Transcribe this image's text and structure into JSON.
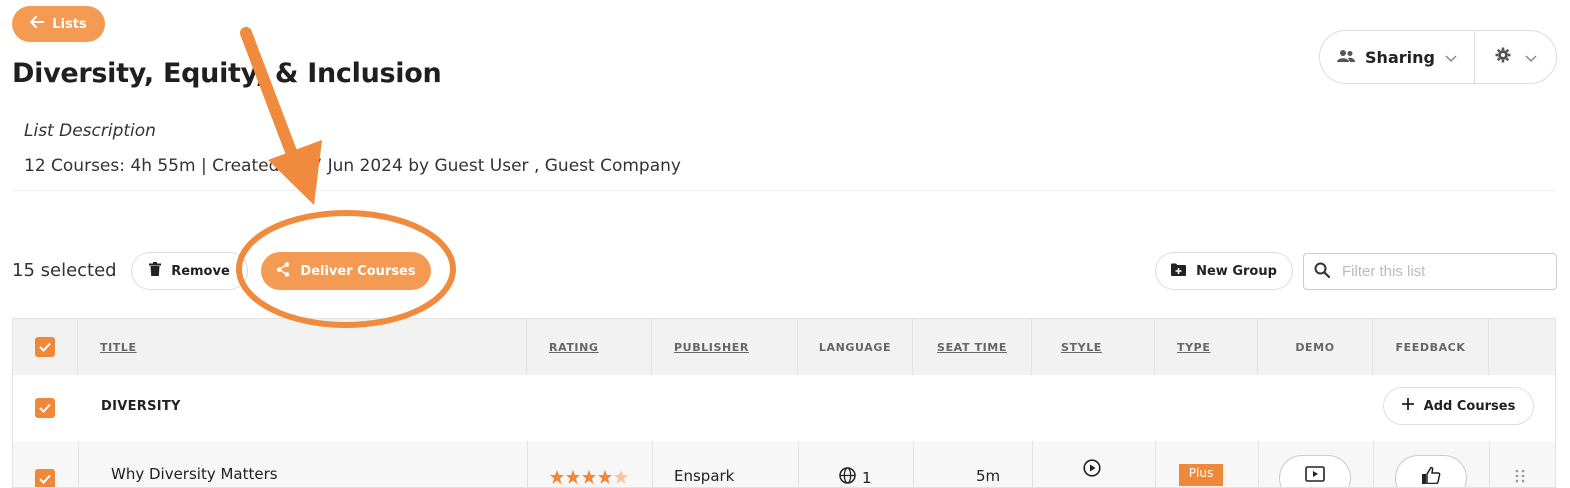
{
  "header": {
    "back_label": "Lists",
    "title": "Diversity, Equity, & Inclusion",
    "description_label": "List Description",
    "meta": "12 Courses: 4h 55m | Created on 7 Jun 2024 by Guest User , Guest Company"
  },
  "sharing": {
    "label": "Sharing"
  },
  "toolbar": {
    "selected": "15 selected",
    "remove_label": "Remove",
    "deliver_label": "Deliver Courses",
    "new_group_label": "New Group",
    "filter_placeholder": "Filter this list"
  },
  "table": {
    "columns": [
      "TITLE",
      "RATING",
      "PUBLISHER",
      "LANGUAGE",
      "SEAT TIME",
      "STYLE",
      "TYPE",
      "DEMO",
      "FEEDBACK"
    ],
    "group": {
      "title": "DIVERSITY",
      "add_label": "Add Courses"
    },
    "row": {
      "title": "Why Diversity Matters",
      "publisher": "Enspark",
      "language_count": "1",
      "seat_time": "5m",
      "type": "Plus"
    }
  },
  "colors": {
    "accent": "#f59a52",
    "checkbox": "#f0883a",
    "annotation": "#f08a3c"
  }
}
